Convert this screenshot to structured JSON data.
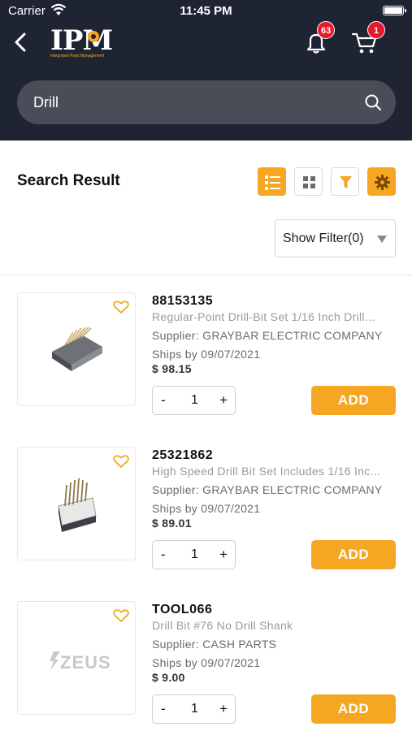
{
  "status_bar": {
    "carrier": "Carrier",
    "time": "11:45 PM"
  },
  "header": {
    "logo_text": "IPM",
    "logo_subtitle": "Integrated Parts Management",
    "notifications_count": "63",
    "cart_count": "1"
  },
  "search": {
    "value": "Drill"
  },
  "results": {
    "title": "Search Result",
    "show_filter_label": "Show Filter(0)"
  },
  "products": [
    {
      "id": "88153135",
      "description": "Regular-Point Drill-Bit Set  1/16 Inch Drill...",
      "supplier": "Supplier: GRAYBAR ELECTRIC COMPANY",
      "ships": "Ships by 09/07/2021",
      "price": "$ 98.15",
      "qty": "1",
      "add_label": "ADD"
    },
    {
      "id": "25321862",
      "description": "High Speed Drill Bit Set Includes  1/16 Inc...",
      "supplier": "Supplier: GRAYBAR ELECTRIC COMPANY",
      "ships": "Ships by 09/07/2021",
      "price": "$ 89.01",
      "qty": "1",
      "add_label": "ADD"
    },
    {
      "id": "TOOL066",
      "description": "Drill Bit #76 No Drill Shank",
      "supplier": "Supplier: CASH PARTS",
      "ships": "Ships by 09/07/2021",
      "price": "$ 9.00",
      "qty": "1",
      "add_label": "ADD",
      "brand_logo_text": "ZEUS"
    }
  ],
  "colors": {
    "header_bg": "#1f2433",
    "accent": "#f5a623",
    "badge": "#e8192c"
  },
  "icons": [
    "back-arrow-icon",
    "bell-icon",
    "cart-icon",
    "search-icon",
    "list-view-icon",
    "grid-view-icon",
    "filter-icon",
    "settings-icon",
    "heart-icon",
    "dropdown-caret-icon"
  ]
}
